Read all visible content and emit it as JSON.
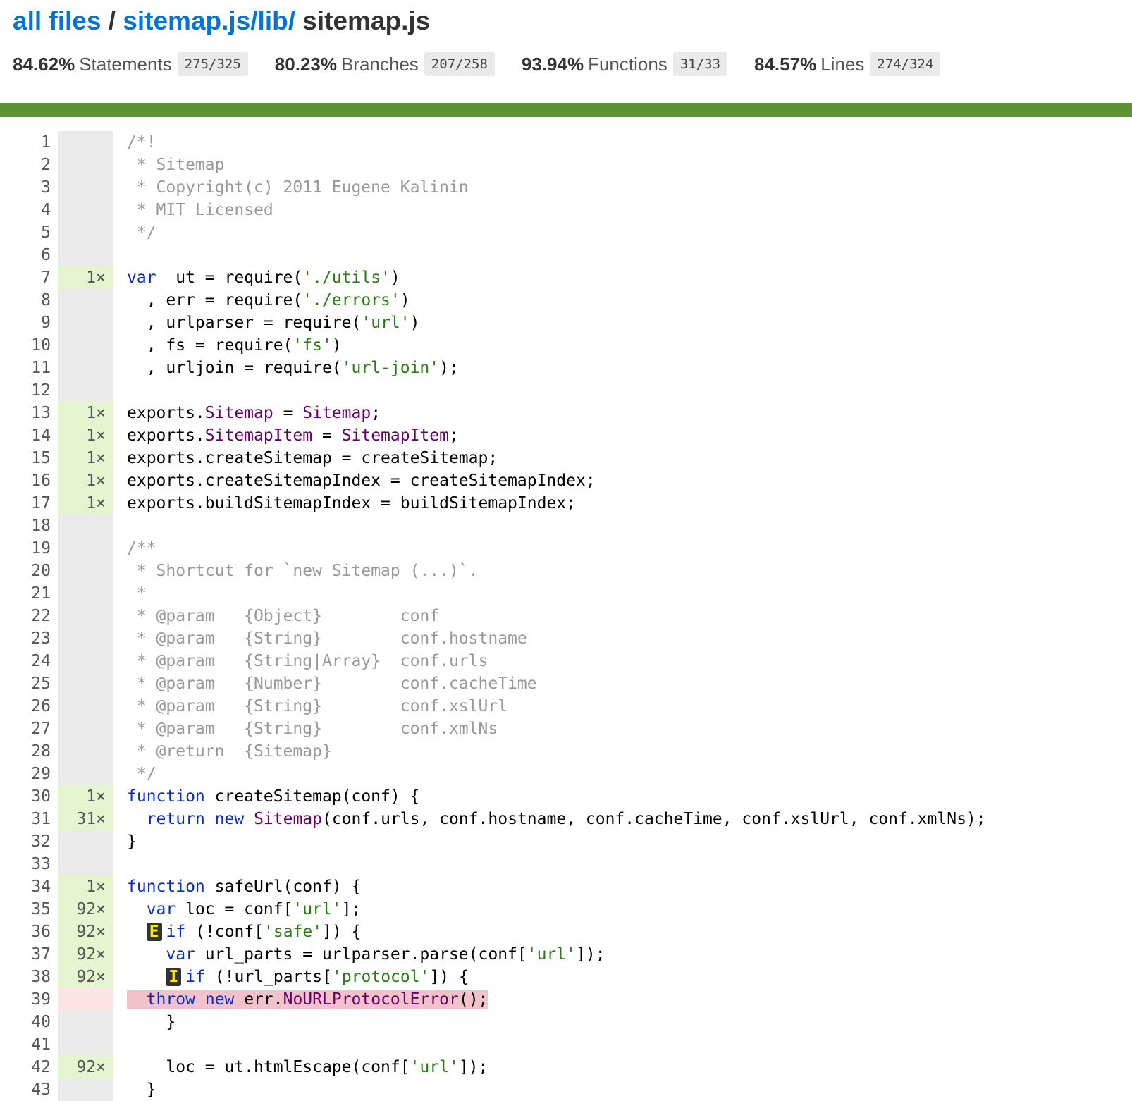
{
  "breadcrumb": {
    "all_files": "all files",
    "sep1": " / ",
    "folder": "sitemap.js/lib/",
    "file": "sitemap.js"
  },
  "stats": [
    {
      "pct": "84.62%",
      "label": "Statements",
      "frac": "275/325"
    },
    {
      "pct": "80.23%",
      "label": "Branches",
      "frac": "207/258"
    },
    {
      "pct": "93.94%",
      "label": "Functions",
      "frac": "31/33"
    },
    {
      "pct": "84.57%",
      "label": "Lines",
      "frac": "274/324"
    }
  ],
  "colors": {
    "link": "#0074D9",
    "status_bar": "#5e9233",
    "covered": "#e6f5d0",
    "uncovered": "#fbe3e6",
    "uncovered_code": "#f1c2cb"
  },
  "lines": [
    {
      "n": "1",
      "h": "",
      "c": "",
      "code": [
        [
          "com",
          "/*!"
        ]
      ]
    },
    {
      "n": "2",
      "h": "",
      "c": "",
      "code": [
        [
          "com",
          " * Sitemap"
        ]
      ]
    },
    {
      "n": "3",
      "h": "",
      "c": "",
      "code": [
        [
          "com",
          " * Copyright(c) 2011 Eugene Kalinin"
        ]
      ]
    },
    {
      "n": "4",
      "h": "",
      "c": "",
      "code": [
        [
          "com",
          " * MIT Licensed"
        ]
      ]
    },
    {
      "n": "5",
      "h": "",
      "c": "",
      "code": [
        [
          "com",
          " */"
        ]
      ]
    },
    {
      "n": "6",
      "h": "",
      "c": "",
      "code": []
    },
    {
      "n": "7",
      "h": "1×",
      "c": "yes",
      "code": [
        [
          "kw",
          "var"
        ],
        [
          "",
          "  ut = require("
        ],
        [
          "str",
          "'./utils'"
        ],
        [
          "",
          ")"
        ]
      ]
    },
    {
      "n": "8",
      "h": "",
      "c": "",
      "code": [
        [
          "",
          "  , err = require("
        ],
        [
          "str",
          "'./errors'"
        ],
        [
          "",
          ")"
        ]
      ]
    },
    {
      "n": "9",
      "h": "",
      "c": "",
      "code": [
        [
          "",
          "  , urlparser = require("
        ],
        [
          "str",
          "'url'"
        ],
        [
          "",
          ")"
        ]
      ]
    },
    {
      "n": "10",
      "h": "",
      "c": "",
      "code": [
        [
          "",
          "  , fs = require("
        ],
        [
          "str",
          "'fs'"
        ],
        [
          "",
          ")"
        ]
      ]
    },
    {
      "n": "11",
      "h": "",
      "c": "",
      "code": [
        [
          "",
          "  , urljoin = require("
        ],
        [
          "str",
          "'url-join'"
        ],
        [
          "",
          ");"
        ]
      ]
    },
    {
      "n": "12",
      "h": "",
      "c": "",
      "code": []
    },
    {
      "n": "13",
      "h": "1×",
      "c": "yes",
      "code": [
        [
          "",
          "exports."
        ],
        [
          "prop",
          "Sitemap"
        ],
        [
          "",
          " = "
        ],
        [
          "prop",
          "Sitemap"
        ],
        [
          "",
          ";"
        ]
      ]
    },
    {
      "n": "14",
      "h": "1×",
      "c": "yes",
      "code": [
        [
          "",
          "exports."
        ],
        [
          "prop",
          "SitemapItem"
        ],
        [
          "",
          " = "
        ],
        [
          "prop",
          "SitemapItem"
        ],
        [
          "",
          ";"
        ]
      ]
    },
    {
      "n": "15",
      "h": "1×",
      "c": "yes",
      "code": [
        [
          "",
          "exports.createSitemap = createSitemap;"
        ]
      ]
    },
    {
      "n": "16",
      "h": "1×",
      "c": "yes",
      "code": [
        [
          "",
          "exports.createSitemapIndex = createSitemapIndex;"
        ]
      ]
    },
    {
      "n": "17",
      "h": "1×",
      "c": "yes",
      "code": [
        [
          "",
          "exports.buildSitemapIndex = buildSitemapIndex;"
        ]
      ]
    },
    {
      "n": "18",
      "h": "",
      "c": "",
      "code": []
    },
    {
      "n": "19",
      "h": "",
      "c": "",
      "code": [
        [
          "com",
          "/**"
        ]
      ]
    },
    {
      "n": "20",
      "h": "",
      "c": "",
      "code": [
        [
          "com",
          " * Shortcut for `new Sitemap (...)`."
        ]
      ]
    },
    {
      "n": "21",
      "h": "",
      "c": "",
      "code": [
        [
          "com",
          " *"
        ]
      ]
    },
    {
      "n": "22",
      "h": "",
      "c": "",
      "code": [
        [
          "com",
          " * @param   {Object}        conf"
        ]
      ]
    },
    {
      "n": "23",
      "h": "",
      "c": "",
      "code": [
        [
          "com",
          " * @param   {String}        conf.hostname"
        ]
      ]
    },
    {
      "n": "24",
      "h": "",
      "c": "",
      "code": [
        [
          "com",
          " * @param   {String|Array}  conf.urls"
        ]
      ]
    },
    {
      "n": "25",
      "h": "",
      "c": "",
      "code": [
        [
          "com",
          " * @param   {Number}        conf.cacheTime"
        ]
      ]
    },
    {
      "n": "26",
      "h": "",
      "c": "",
      "code": [
        [
          "com",
          " * @param   {String}        conf.xslUrl"
        ]
      ]
    },
    {
      "n": "27",
      "h": "",
      "c": "",
      "code": [
        [
          "com",
          " * @param   {String}        conf.xmlNs"
        ]
      ]
    },
    {
      "n": "28",
      "h": "",
      "c": "",
      "code": [
        [
          "com",
          " * @return  {Sitemap}"
        ]
      ]
    },
    {
      "n": "29",
      "h": "",
      "c": "",
      "code": [
        [
          "com",
          " */"
        ]
      ]
    },
    {
      "n": "30",
      "h": "1×",
      "c": "yes",
      "code": [
        [
          "kw",
          "function"
        ],
        [
          "",
          " createSitemap(conf) {"
        ]
      ]
    },
    {
      "n": "31",
      "h": "31×",
      "c": "yes",
      "code": [
        [
          "",
          "  "
        ],
        [
          "kw",
          "return"
        ],
        [
          "",
          " "
        ],
        [
          "kw",
          "new"
        ],
        [
          "",
          " "
        ],
        [
          "typ",
          "Sitemap"
        ],
        [
          "",
          "(conf.urls, conf.hostname, conf.cacheTime, conf.xslUrl, conf.xmlNs);"
        ]
      ]
    },
    {
      "n": "32",
      "h": "",
      "c": "",
      "code": [
        [
          "",
          "}"
        ]
      ]
    },
    {
      "n": "33",
      "h": "",
      "c": "",
      "code": []
    },
    {
      "n": "34",
      "h": "1×",
      "c": "yes",
      "code": [
        [
          "kw",
          "function"
        ],
        [
          "",
          " safeUrl(conf) {"
        ]
      ]
    },
    {
      "n": "35",
      "h": "92×",
      "c": "yes",
      "code": [
        [
          "",
          "  "
        ],
        [
          "kw",
          "var"
        ],
        [
          "",
          " loc = conf["
        ],
        [
          "str",
          "'url'"
        ],
        [
          "",
          "];"
        ]
      ]
    },
    {
      "n": "36",
      "h": "92×",
      "c": "yes",
      "code": [
        [
          "",
          "  "
        ],
        [
          "badge",
          "E"
        ],
        [
          "kw",
          "if"
        ],
        [
          "",
          " (!conf["
        ],
        [
          "str",
          "'safe'"
        ],
        [
          "",
          "]) {"
        ]
      ]
    },
    {
      "n": "37",
      "h": "92×",
      "c": "yes",
      "code": [
        [
          "",
          "    "
        ],
        [
          "kw",
          "var"
        ],
        [
          "",
          " url_parts = urlparser.parse(conf["
        ],
        [
          "str",
          "'url'"
        ],
        [
          "",
          "]);"
        ]
      ]
    },
    {
      "n": "38",
      "h": "92×",
      "c": "yes",
      "code": [
        [
          "",
          "    "
        ],
        [
          "badge",
          "I"
        ],
        [
          "kw",
          "if"
        ],
        [
          "",
          " (!url_parts["
        ],
        [
          "str",
          "'protocol'"
        ],
        [
          "",
          "]) {"
        ]
      ]
    },
    {
      "n": "39",
      "h": "",
      "c": "no",
      "code": [
        [
          "uncov",
          "  "
        ],
        [
          "uncov kw",
          "throw"
        ],
        [
          "uncov",
          " "
        ],
        [
          "uncov kw",
          "new"
        ],
        [
          "uncov",
          " err."
        ],
        [
          "uncov typ",
          "NoURLProtocolError"
        ],
        [
          "uncov",
          "();"
        ]
      ]
    },
    {
      "n": "40",
      "h": "",
      "c": "",
      "code": [
        [
          "",
          "    }"
        ]
      ]
    },
    {
      "n": "41",
      "h": "",
      "c": "",
      "code": []
    },
    {
      "n": "42",
      "h": "92×",
      "c": "yes",
      "code": [
        [
          "",
          "    loc = ut.htmlEscape(conf["
        ],
        [
          "str",
          "'url'"
        ],
        [
          "",
          "]);"
        ]
      ]
    },
    {
      "n": "43",
      "h": "",
      "c": "",
      "code": [
        [
          "",
          "  }"
        ]
      ]
    }
  ]
}
